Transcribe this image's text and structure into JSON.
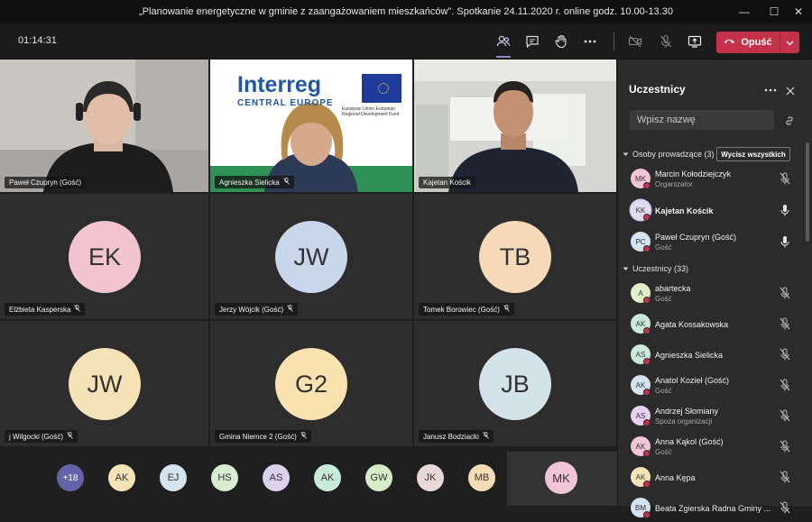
{
  "window": {
    "title": "„Planowanie energetyczne w gminie z zaangażowaniem mieszkańców\". Spotkanie 24.11.2020 r. online godz. 10.00-13.30"
  },
  "toolbar": {
    "timer": "01:14:31",
    "leave_label": "Opuść"
  },
  "tiles": [
    {
      "name": "Paweł Czupryn (Gość)",
      "type": "video"
    },
    {
      "name": "Agnieszka Sielicka",
      "type": "video",
      "banner": "Interreg",
      "banner_sub": "CENTRAL EUROPE",
      "eu_text": "European Union European Regional Development Fund"
    },
    {
      "name": "Kajetan Kościk",
      "type": "video"
    },
    {
      "name": "Elżbieta Kasperska",
      "initials": "EK",
      "color": "#f2c4d0"
    },
    {
      "name": "Jerzy Wójcik (Gość)",
      "initials": "JW",
      "color": "#c9d5ea"
    },
    {
      "name": "Tomek Borowiec (Gość)",
      "initials": "TB",
      "color": "#f6d9b8"
    },
    {
      "name": "j Wilgocki (Gość)",
      "initials": "JW",
      "color": "#f5e2b6"
    },
    {
      "name": "Gmina Niemce 2 (Gość)",
      "initials": "G2",
      "color": "#f7e2b0"
    },
    {
      "name": "Janusz Bodziacki",
      "initials": "JB",
      "color": "#d4e3e8"
    }
  ],
  "strip": {
    "overflow": "+18",
    "avatars": [
      {
        "initials": "AK",
        "color": "#f5e2b6"
      },
      {
        "initials": "EJ",
        "color": "#d4e3ee"
      },
      {
        "initials": "HS",
        "color": "#d8ecd2"
      },
      {
        "initials": "AS",
        "color": "#dcd2ee"
      },
      {
        "initials": "AK",
        "color": "#c9ead9"
      },
      {
        "initials": "GW",
        "color": "#d6ecc8"
      },
      {
        "initials": "JK",
        "color": "#ead8d8"
      },
      {
        "initials": "MB",
        "color": "#f6dcb4"
      }
    ],
    "self_initials": "MK",
    "self_color": "#f2c4d8"
  },
  "panel": {
    "title": "Uczestnicy",
    "search_placeholder": "Wpisz nazwę",
    "presenters_header": "Osoby prowadzące (3)",
    "mute_all": "Wycisz wszystkich",
    "attendees_header": "Uczestnicy (33)",
    "presenters": [
      {
        "initials": "MK",
        "name": "Marcin Kołodziejczyk",
        "role": "Organizator",
        "color": "#f2c4d8",
        "mic": "muted"
      },
      {
        "initials": "KK",
        "name": "Kajetan Kościk",
        "role": "",
        "color": "#e0dcee",
        "mic": "on",
        "bold": true
      },
      {
        "initials": "PC",
        "name": "Paweł Czupryn (Gość)",
        "role": "Gość",
        "color": "#d4e3ee",
        "mic": "on"
      }
    ],
    "attendees": [
      {
        "initials": "A",
        "name": "abartecka",
        "role": "Gość",
        "color": "#dff0c8"
      },
      {
        "initials": "AK",
        "name": "Agata Kossakowska",
        "role": "",
        "color": "#c9ead9"
      },
      {
        "initials": "AS",
        "name": "Agnieszka Sielicka",
        "role": "",
        "color": "#c9ead9"
      },
      {
        "initials": "AK",
        "name": "Anatol Kozieł (Gość)",
        "role": "Gość",
        "color": "#d4e3ee"
      },
      {
        "initials": "AS",
        "name": "Andrzej Słomiany",
        "role": "Spoza organizacji",
        "color": "#e6d2ee"
      },
      {
        "initials": "AK",
        "name": "Anna Kąkol (Gość)",
        "role": "Gość",
        "color": "#f2c4d8"
      },
      {
        "initials": "AK",
        "name": "Anna Kępa",
        "role": "",
        "color": "#f6e2b6"
      },
      {
        "initials": "BM",
        "name": "Beata Zgierska Radna Gminy ...",
        "role": "",
        "color": "#d4e3ee"
      }
    ]
  }
}
